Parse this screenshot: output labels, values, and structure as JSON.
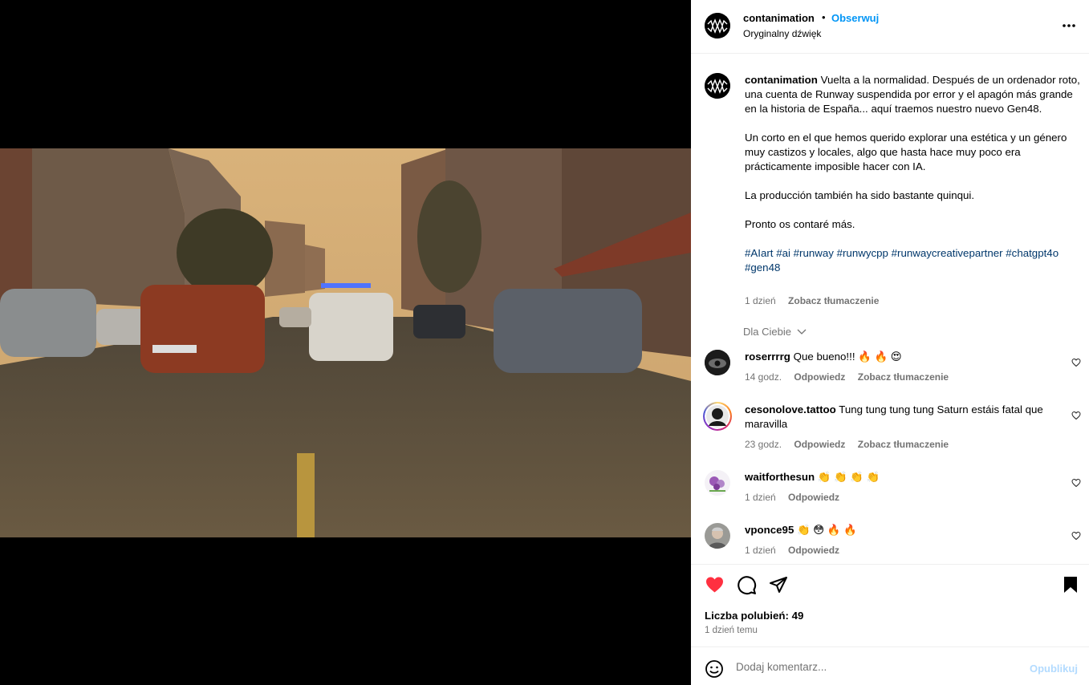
{
  "header": {
    "username": "contanimation",
    "separator": "•",
    "follow_label": "Obserwuj",
    "audio_label": "Oryginalny dźwięk",
    "more_icon": "more-horizontal-icon"
  },
  "caption": {
    "username": "contanimation",
    "paragraphs": [
      "Vuelta a la normalidad. Después de un ordenador roto, una cuenta de Runway suspendida por error y el apagón más grande en la historia de España... aquí traemos nuestro nuevo Gen48.",
      "Un corto en el que hemos querido explorar una estética y un género muy castizos y locales, algo que hasta hace muy poco era prácticamente imposible hacer con IA.",
      "La producción también ha sido bastante quinqui.",
      "Pronto os contaré más."
    ],
    "hashtags": [
      "#AIart",
      "#ai",
      "#runway",
      "#runwycpp",
      "#runwaycreativepartner",
      "#chatgpt4o",
      "#gen48"
    ],
    "time": "1 dzień",
    "translate_label": "Zobacz tłumaczenie"
  },
  "filter_label": "Dla Ciebie",
  "comments": [
    {
      "username": "roserrrrg",
      "text": "Que bueno!!! 🔥 🔥 😍",
      "time": "14 godz.",
      "reply_label": "Odpowiedz",
      "translate_label": "Zobacz tłumaczenie"
    },
    {
      "username": "cesonolove.tattoo",
      "text": "Tung tung tung tung Saturn estáis fatal que maravilla",
      "time": "23 godz.",
      "reply_label": "Odpowiedz",
      "translate_label": "Zobacz tłumaczenie"
    },
    {
      "username": "waitforthesun",
      "text": "👏 👏 👏 👏",
      "time": "1 dzień",
      "reply_label": "Odpowiedz"
    },
    {
      "username": "vponce95",
      "text": "👏 😳 🔥 🔥",
      "time": "1 dzień",
      "reply_label": "Odpowiedz"
    }
  ],
  "actions": {
    "like_icon": "heart-filled-icon",
    "comment_icon": "comment-icon",
    "share_icon": "send-icon",
    "save_icon": "bookmark-filled-icon",
    "likes_label": "Liczba polubień: 49",
    "posted_ago": "1 dzień temu"
  },
  "composer": {
    "placeholder": "Dodaj komentarz...",
    "publish_label": "Opublikuj"
  },
  "colors": {
    "link": "#0095f6",
    "hashtag": "#00376b",
    "like": "#ff3040",
    "muted": "#737373",
    "publish_disabled": "#b3dbff"
  }
}
